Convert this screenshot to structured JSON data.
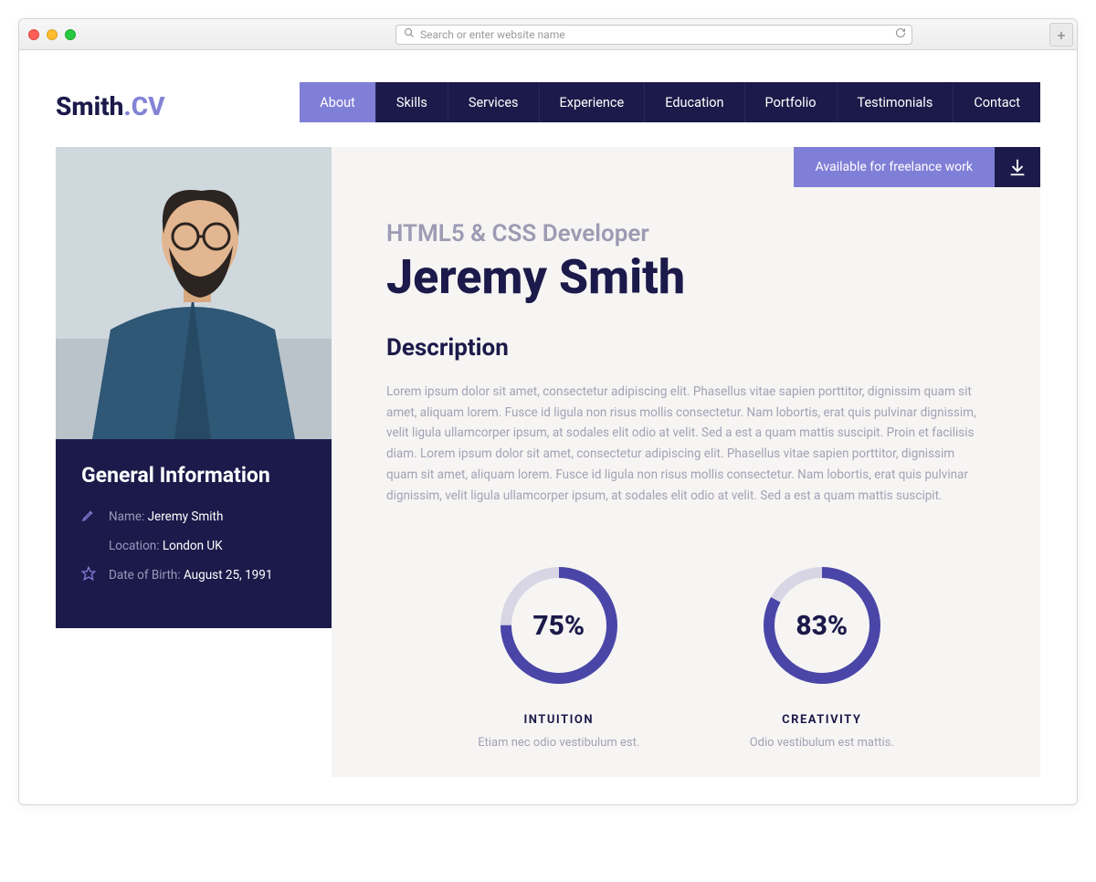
{
  "browser": {
    "placeholder": "Search or enter website name"
  },
  "logo": {
    "part1": "Smith",
    "part2": ".CV"
  },
  "nav": {
    "about": "About",
    "skills": "Skills",
    "services": "Services",
    "experience": "Experience",
    "education": "Education",
    "portfolio": "Portfolio",
    "testimonials": "Testimonials",
    "contact": "Contact"
  },
  "banner": {
    "available": "Available for freelance work"
  },
  "hero": {
    "subtitle": "HTML5 & CSS Developer",
    "name": "Jeremy Smith"
  },
  "description": {
    "heading": "Description",
    "body": "Lorem ipsum dolor sit amet, consectetur adipiscing elit. Phasellus vitae sapien porttitor, dignissim quam sit amet, aliquam lorem. Fusce id ligula non risus mollis consectetur. Nam lobortis, erat quis pulvinar dignissim, velit ligula ullamcorper ipsum, at sodales elit odio at velit. Sed a est a quam mattis suscipit. Proin et facilisis diam. Lorem ipsum dolor sit amet, consectetur adipiscing elit. Phasellus vitae sapien porttitor, dignissim quam sit amet, aliquam lorem. Fusce id ligula non risus mollis consectetur. Nam lobortis, erat quis pulvinar dignissim, velit ligula ullamcorper ipsum, at sodales elit odio at velit. Sed a est a quam mattis suscipit."
  },
  "general": {
    "heading": "General Information",
    "name_label": "Name:",
    "name_value": "Jeremy Smith",
    "location_label": "Location:",
    "location_value": "London UK",
    "dob_label": "Date of Birth:",
    "dob_value": "August 25, 1991"
  },
  "chart_data": [
    {
      "type": "pie",
      "title": "INTUITION",
      "subtitle": "Etiam nec odio vestibulum est.",
      "value": 75,
      "label": "75%",
      "max": 100
    },
    {
      "type": "pie",
      "title": "CREATIVITY",
      "subtitle": "Odio vestibulum est mattis.",
      "value": 83,
      "label": "83%",
      "max": 100
    }
  ]
}
